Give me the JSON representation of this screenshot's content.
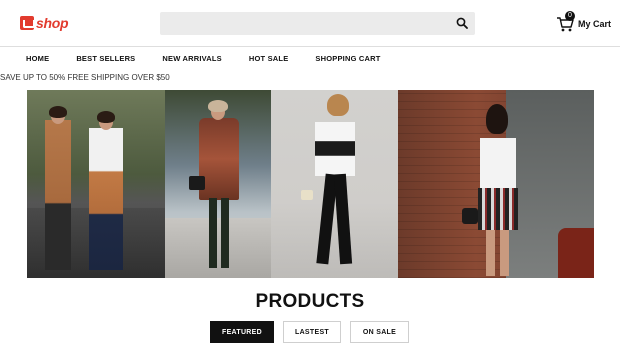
{
  "brand": {
    "logo_text": "shop",
    "color": "#e23b2e"
  },
  "search": {
    "placeholder": "",
    "icon": "search-icon"
  },
  "cart": {
    "count": "0",
    "label": "My Cart",
    "icon": "shopping-cart-icon"
  },
  "nav": {
    "items": [
      {
        "label": "HOME"
      },
      {
        "label": "BEST SELLERS"
      },
      {
        "label": "NEW ARRIVALS"
      },
      {
        "label": "HOT SALE"
      },
      {
        "label": "SHOPPING CART"
      }
    ]
  },
  "promo": {
    "text": "SAVE UP TO 50% FREE SHIPPING OVER $50"
  },
  "hero": {
    "panels": [
      "street-style-autumn-cape",
      "street-style-poncho-boots",
      "street-style-striped-top",
      "street-style-plaid-skirt"
    ]
  },
  "products": {
    "title": "PRODUCTS",
    "tabs": [
      {
        "label": "FEATURED",
        "active": true
      },
      {
        "label": "LASTEST",
        "active": false
      },
      {
        "label": "ON SALE",
        "active": false
      }
    ]
  }
}
